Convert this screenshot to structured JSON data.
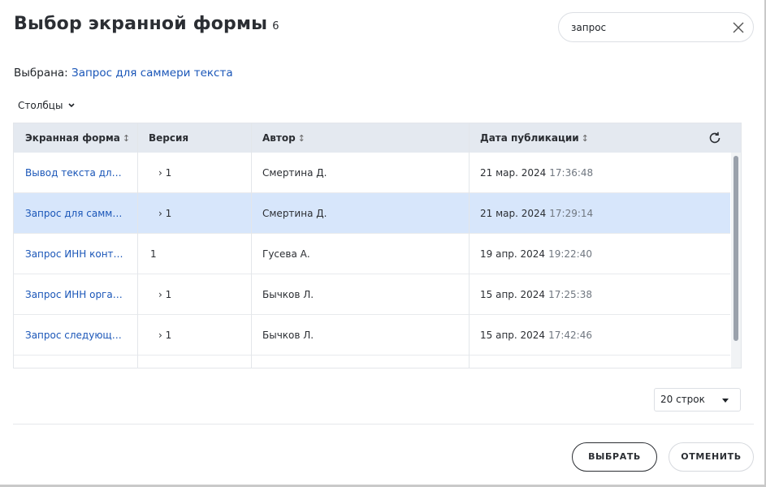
{
  "dialog": {
    "title": "Выбор экранной формы",
    "count": "6"
  },
  "search": {
    "value": "запрос",
    "placeholder": ""
  },
  "selection": {
    "label": "Выбрана:",
    "value": "Запрос для саммери текста"
  },
  "columns_button": {
    "label": "Столбцы",
    "icon": "chevron-down-icon"
  },
  "table": {
    "headers": {
      "form": "Экранная форма",
      "version": "Версия",
      "author": "Автор",
      "date": "Дата публикации"
    },
    "sort_icon": "↕",
    "rows": [
      {
        "form": "Вывод текста для …",
        "expand": "›",
        "version": "1",
        "author": "Смертина Д.",
        "date": "21 мар. 2024",
        "time": "17:36:48"
      },
      {
        "form": "Запрос для самме…",
        "expand": "›",
        "version": "1",
        "author": "Смертина Д.",
        "date": "21 мар. 2024",
        "time": "17:29:14"
      },
      {
        "form": "Запрос ИНН контр…",
        "expand": "",
        "version": "1",
        "author": "Гусева А.",
        "date": "19 апр. 2024",
        "time": "19:22:40"
      },
      {
        "form": "Запрос ИНН орган…",
        "expand": "›",
        "version": "1",
        "author": "Бычков Л.",
        "date": "15 апр. 2024",
        "time": "17:25:38"
      },
      {
        "form": "Запрос следующе…",
        "expand": "›",
        "version": "1",
        "author": "Бычков Л.",
        "date": "15 апр. 2024",
        "time": "17:42:46"
      }
    ],
    "selected_row_index": 1
  },
  "pagination": {
    "rows_per_page": "20 строк"
  },
  "buttons": {
    "select": "ВЫБРАТЬ",
    "cancel": "ОТМЕНИТЬ"
  },
  "colors": {
    "link": "#1a56b8",
    "header_bg": "#e4e9f0",
    "selected_row_bg": "#d7e6fb"
  }
}
